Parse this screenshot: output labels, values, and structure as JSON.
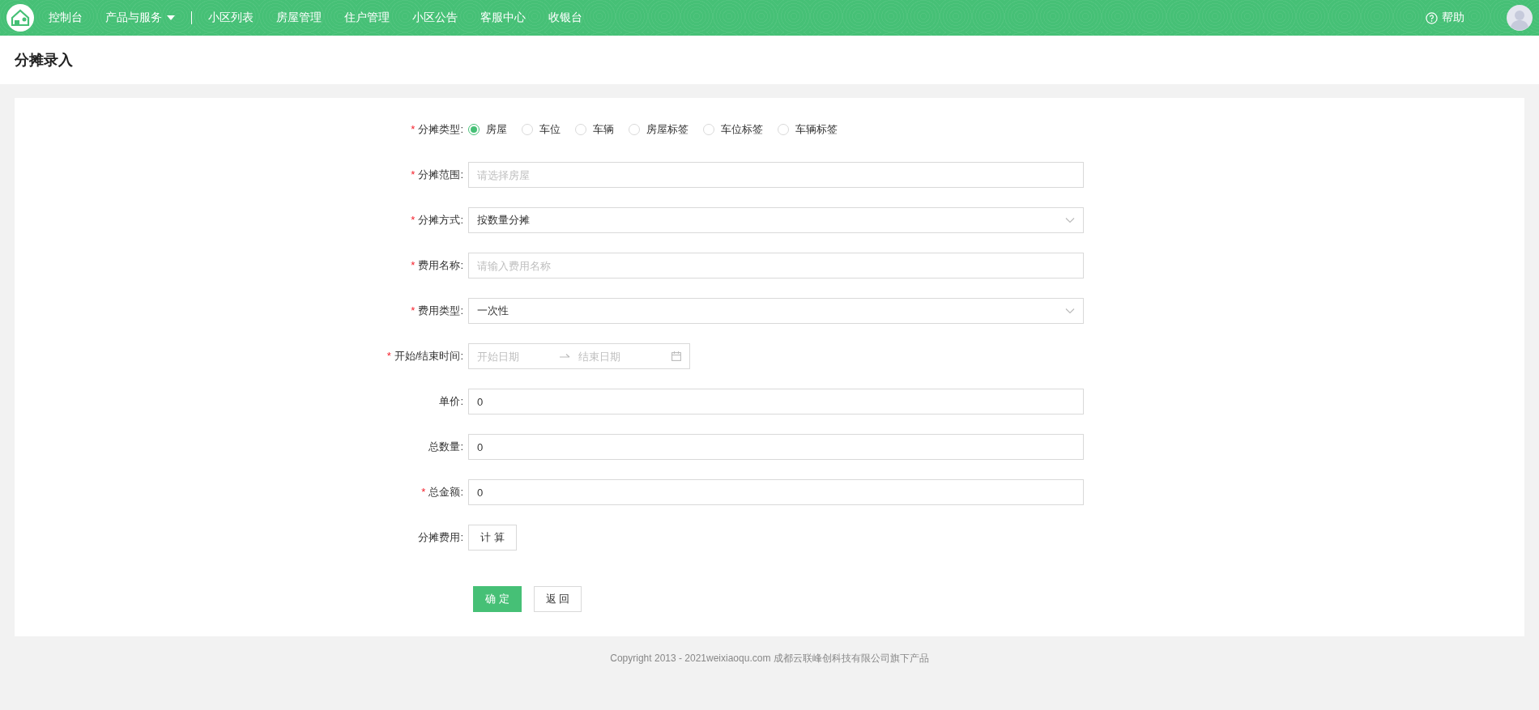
{
  "top_nav": {
    "items": [
      {
        "label": "控制台",
        "kind": "link"
      },
      {
        "label": "产品与服务",
        "kind": "dropdown"
      },
      {
        "label": "小区列表",
        "kind": "link"
      },
      {
        "label": "房屋管理",
        "kind": "link"
      },
      {
        "label": "住户管理",
        "kind": "link"
      },
      {
        "label": "小区公告",
        "kind": "link"
      },
      {
        "label": "客服中心",
        "kind": "link"
      },
      {
        "label": "收银台",
        "kind": "link"
      }
    ],
    "help": "帮助"
  },
  "page_title": "分摊录入",
  "form": {
    "rows": [
      {
        "kind": "radio",
        "label": "分摊类型:",
        "required_mark": "*",
        "options": [
          {
            "label": "房屋",
            "selected": true
          },
          {
            "label": "车位",
            "selected": false
          },
          {
            "label": "车辆",
            "selected": false
          },
          {
            "label": "房屋标签",
            "selected": false
          },
          {
            "label": "车位标签",
            "selected": false
          },
          {
            "label": "车辆标签",
            "selected": false
          }
        ]
      },
      {
        "kind": "input",
        "label": "分摊范围:",
        "required_mark": "*",
        "placeholder": "请选择房屋"
      },
      {
        "kind": "select",
        "label": "分摊方式:",
        "required_mark": "*",
        "value": "按数量分摊"
      },
      {
        "kind": "input",
        "label": "费用名称:",
        "required_mark": "*",
        "placeholder": "请输入费用名称"
      },
      {
        "kind": "select",
        "label": "费用类型:",
        "required_mark": "*",
        "value": "一次性"
      },
      {
        "kind": "daterange",
        "label": "开始/结束时间:",
        "required_mark": "*",
        "start_placeholder": "开始日期",
        "end_placeholder": "结束日期"
      },
      {
        "kind": "input",
        "label": "单价:",
        "value": "0"
      },
      {
        "kind": "input",
        "label": "总数量:",
        "value": "0"
      },
      {
        "kind": "input",
        "label": "总金额:",
        "required_mark": "*",
        "value": "0"
      },
      {
        "kind": "button",
        "label": "分摊费用:",
        "button": "计 算"
      }
    ],
    "actions": [
      {
        "label": "确 定",
        "kind": "primary"
      },
      {
        "label": "返 回",
        "kind": "default"
      }
    ]
  },
  "footer": "Copyright 2013 - 2021weixiaoqu.com 成都云联峰创科技有限公司旗下产品"
}
